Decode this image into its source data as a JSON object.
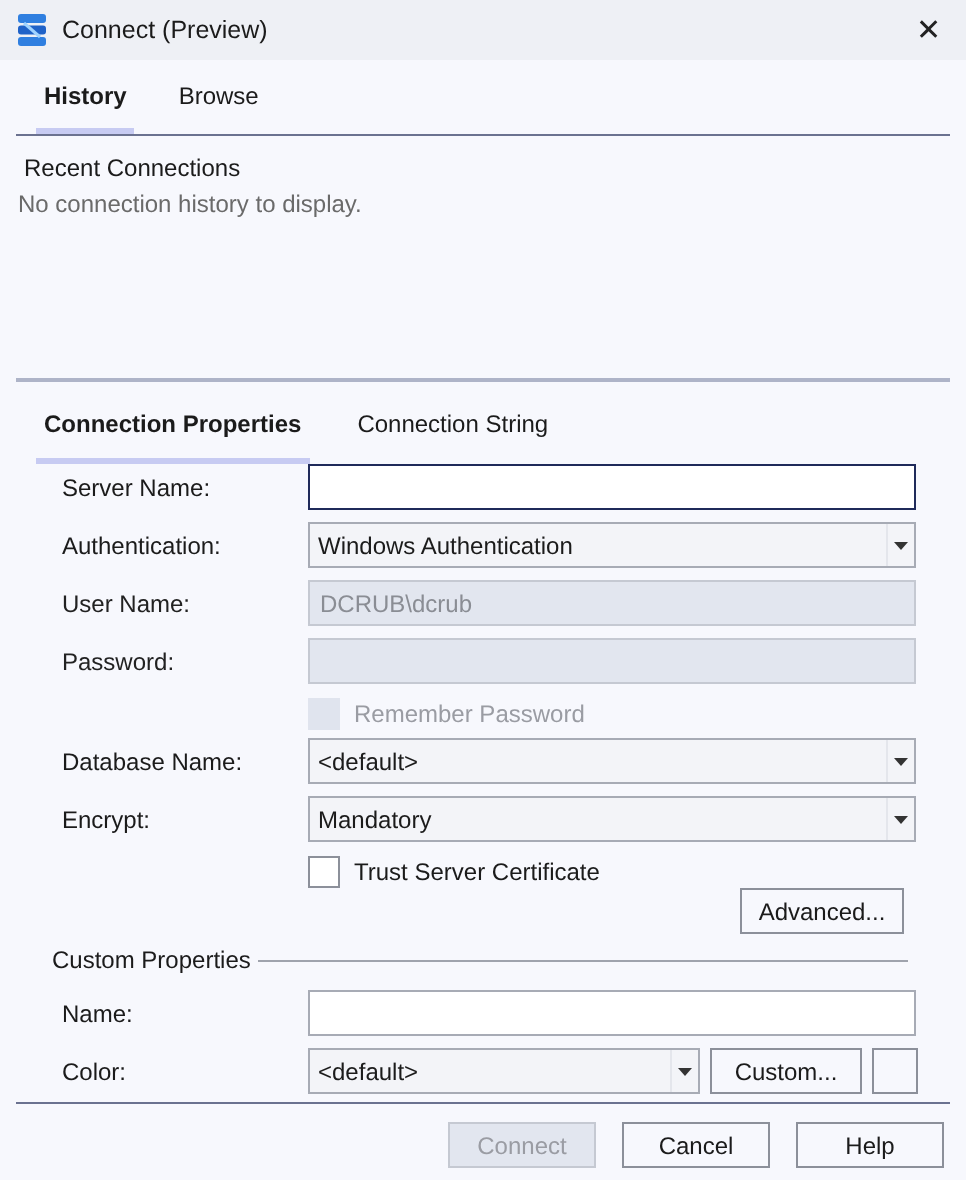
{
  "window": {
    "title": "Connect (Preview)",
    "close": "✕"
  },
  "top_tabs": [
    {
      "label": "History",
      "selected": true
    },
    {
      "label": "Browse",
      "selected": false
    }
  ],
  "recent": {
    "heading": "Recent Connections",
    "empty_message": "No connection history to display."
  },
  "property_tabs": [
    {
      "label": "Connection Properties",
      "selected": true
    },
    {
      "label": "Connection String",
      "selected": false
    }
  ],
  "fields": [
    {
      "kind": "text",
      "label": "Server Name:",
      "focused": true,
      "disabled": false
    },
    {
      "kind": "select",
      "label": "Authentication:",
      "value": "Windows Authentication",
      "disabled": false
    },
    {
      "kind": "text",
      "label": "User Name:",
      "value": "DCRUB\\dcrub",
      "disabled": true
    },
    {
      "kind": "text",
      "label": "Password:",
      "disabled": true
    },
    {
      "kind": "checkbox",
      "label": "Remember Password",
      "checked": false,
      "disabled": true
    },
    {
      "kind": "select",
      "label": "Database Name:",
      "value": "<default>",
      "disabled": false
    },
    {
      "kind": "select",
      "label": "Encrypt:",
      "value": "Mandatory",
      "disabled": false
    },
    {
      "kind": "checkbox",
      "label": "Trust Server Certificate",
      "checked": false,
      "disabled": false
    }
  ],
  "advanced_button": "Advanced...",
  "custom_properties": {
    "heading": "Custom Properties",
    "name_label": "Name:",
    "color_label": "Color:",
    "color_value": "<default>",
    "custom_button": "Custom..."
  },
  "buttons": [
    {
      "label": "Connect",
      "disabled": true
    },
    {
      "label": "Cancel",
      "disabled": false
    },
    {
      "label": "Help",
      "disabled": false
    }
  ]
}
